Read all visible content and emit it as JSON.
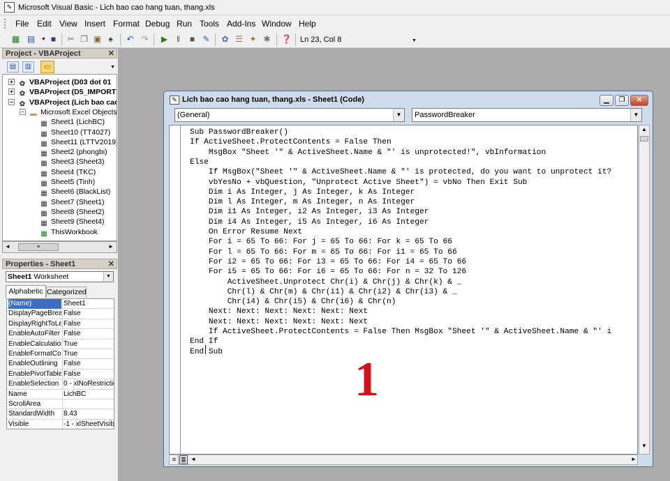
{
  "app": {
    "title": "Microsoft Visual Basic - Lich bao cao hang tuan, thang.xls"
  },
  "menu": [
    "File",
    "Edit",
    "View",
    "Insert",
    "Format",
    "Debug",
    "Run",
    "Tools",
    "Add-Ins",
    "Window",
    "Help"
  ],
  "toolbar": {
    "position": "Ln 23, Col 8"
  },
  "project": {
    "header": "Project - VBAProject",
    "tree": [
      {
        "label": "VBAProject (D03 dot 01 ",
        "bold": true,
        "level": 0,
        "expander": "+"
      },
      {
        "label": "VBAProject (D5_IMPORT",
        "bold": true,
        "level": 0,
        "expander": "+"
      },
      {
        "label": "VBAProject (Lich bao cao",
        "bold": true,
        "level": 0,
        "expander": "−"
      },
      {
        "label": "Microsoft Excel Objects",
        "bold": false,
        "level": 1,
        "expander": "−"
      },
      {
        "label": "Sheet1 (LichBC)",
        "bold": false,
        "level": 2
      },
      {
        "label": "Sheet10 (TT4027)",
        "bold": false,
        "level": 2
      },
      {
        "label": "Sheet11 (LTTV2019)",
        "bold": false,
        "level": 2
      },
      {
        "label": "Sheet2 (phongbi)",
        "bold": false,
        "level": 2
      },
      {
        "label": "Sheet3 (Sheet3)",
        "bold": false,
        "level": 2
      },
      {
        "label": "Sheet4 (TKC)",
        "bold": false,
        "level": 2
      },
      {
        "label": "Sheet5 (Tinh)",
        "bold": false,
        "level": 2
      },
      {
        "label": "Sheet6 (BlackList)",
        "bold": false,
        "level": 2
      },
      {
        "label": "Sheet7 (Sheet1)",
        "bold": false,
        "level": 2
      },
      {
        "label": "Sheet8 (Sheet2)",
        "bold": false,
        "level": 2
      },
      {
        "label": "Sheet9 (Sheet4)",
        "bold": false,
        "level": 2
      },
      {
        "label": "ThisWorkbook",
        "bold": false,
        "level": 2
      }
    ]
  },
  "properties": {
    "header": "Properties - Sheet1",
    "object_name": "Sheet1",
    "object_type": "Worksheet",
    "tabs": [
      "Alphabetic",
      "Categorized"
    ],
    "rows": [
      {
        "name": "(Name)",
        "value": "Sheet1"
      },
      {
        "name": "DisplayPageBreak",
        "value": "False"
      },
      {
        "name": "DisplayRightToLef",
        "value": "False"
      },
      {
        "name": "EnableAutoFilter",
        "value": "False"
      },
      {
        "name": "EnableCalculation",
        "value": "True"
      },
      {
        "name": "EnableFormatCon",
        "value": "True"
      },
      {
        "name": "EnableOutlining",
        "value": "False"
      },
      {
        "name": "EnablePivotTable",
        "value": "False"
      },
      {
        "name": "EnableSelection",
        "value": "0 - xlNoRestrictio"
      },
      {
        "name": "Name",
        "value": "LichBC"
      },
      {
        "name": "ScrollArea",
        "value": ""
      },
      {
        "name": "StandardWidth",
        "value": "8.43"
      },
      {
        "name": "Visible",
        "value": "-1 - xlSheetVisib"
      }
    ]
  },
  "code_window": {
    "title": "Lich bao cao hang tuan, thang.xls - Sheet1 (Code)",
    "object_combo": "(General)",
    "proc_combo": "PasswordBreaker",
    "lines": [
      "Sub PasswordBreaker()",
      "If ActiveSheet.ProtectContents = False Then",
      "    MsgBox \"Sheet '\" & ActiveSheet.Name & \"' is unprotected!\", vbInformation",
      "Else",
      "    If MsgBox(\"Sheet '\" & ActiveSheet.Name & \"' is protected, do you want to unprotect it?",
      "    vbYesNo + vbQuestion, \"Unprotect Active Sheet\") = vbNo Then Exit Sub",
      "    Dim i As Integer, j As Integer, k As Integer",
      "    Dim l As Integer, m As Integer, n As Integer",
      "    Dim i1 As Integer, i2 As Integer, i3 As Integer",
      "    Dim i4 As Integer, i5 As Integer, i6 As Integer",
      "    On Error Resume Next",
      "    For i = 65 To 66: For j = 65 To 66: For k = 65 To 66",
      "    For l = 65 To 66: For m = 65 To 66: For i1 = 65 To 66",
      "    For i2 = 65 To 66: For i3 = 65 To 66: For i4 = 65 To 66",
      "    For i5 = 65 To 66: For i6 = 65 To 66: For n = 32 To 126",
      "        ActiveSheet.Unprotect Chr(i) & Chr(j) & Chr(k) & _",
      "        Chr(l) & Chr(m) & Chr(i1) & Chr(i2) & Chr(i3) & _",
      "        Chr(i4) & Chr(i5) & Chr(i6) & Chr(n)",
      "    Next: Next: Next: Next: Next: Next",
      "    Next: Next: Next: Next: Next: Next",
      "    If ActiveSheet.ProtectContents = False Then MsgBox \"Sheet '\" & ActiveSheet.Name & \"' i",
      "End If",
      "End Sub"
    ]
  },
  "annotation": "1",
  "colors": {
    "annotation": "#d4121b",
    "keyword": "#000080",
    "workspace": "#ababab"
  }
}
